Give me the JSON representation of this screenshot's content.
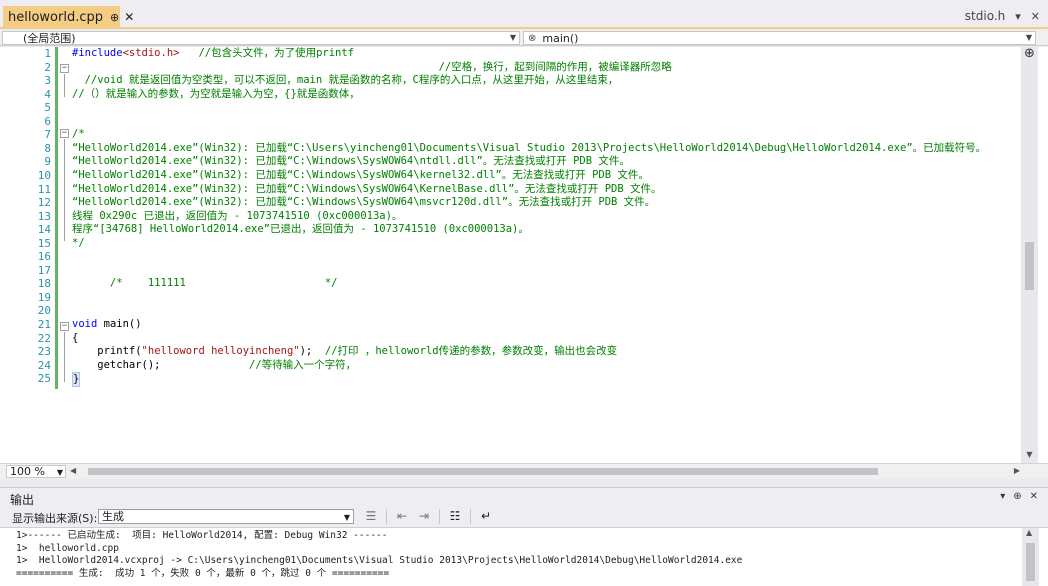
{
  "tabs": {
    "active": {
      "name": "helloworld.cpp",
      "pin": "⊕",
      "close": "✕"
    },
    "secondary": "stdio.h",
    "dropdown_icon": "▾",
    "close_icon": "✕"
  },
  "navbar": {
    "scope": "(全局范围)",
    "member": "main()"
  },
  "editor": {
    "lines": [
      {
        "n": "1",
        "parts": [
          [
            "pp",
            "#include"
          ],
          [
            "str",
            "<stdio.h>"
          ],
          [
            "cmt",
            "   //包含头文件，为了使用printf"
          ]
        ]
      },
      {
        "n": "2",
        "parts": [
          [
            "cmt",
            "                                                          //空格，换行，起到间隔的作用，被编译器所忽略"
          ]
        ]
      },
      {
        "n": "3",
        "parts": [
          [
            "cmt",
            "  //void 就是返回值为空类型，可以不返回，main 就是函数的名称，C程序的入口点，从这里开始，从这里结束，"
          ]
        ]
      },
      {
        "n": "4",
        "parts": [
          [
            "cmt",
            "//（）就是输入的参数，为空就是输入为空，{}就是函数体，"
          ]
        ]
      },
      {
        "n": "5",
        "parts": []
      },
      {
        "n": "6",
        "parts": []
      },
      {
        "n": "7",
        "parts": [
          [
            "cmt",
            "/*"
          ]
        ]
      },
      {
        "n": "8",
        "parts": [
          [
            "cmt",
            "“HelloWorld2014.exe”(Win32): 已加载“C:\\Users\\yincheng01\\Documents\\Visual Studio 2013\\Projects\\HelloWorld2014\\Debug\\HelloWorld2014.exe”。已加载符号。"
          ]
        ]
      },
      {
        "n": "9",
        "parts": [
          [
            "cmt",
            "“HelloWorld2014.exe”(Win32): 已加载“C:\\Windows\\SysWOW64\\ntdll.dll”。无法查找或打开 PDB 文件。"
          ]
        ]
      },
      {
        "n": "10",
        "parts": [
          [
            "cmt",
            "“HelloWorld2014.exe”(Win32): 已加载“C:\\Windows\\SysWOW64\\kernel32.dll”。无法查找或打开 PDB 文件。"
          ]
        ]
      },
      {
        "n": "11",
        "parts": [
          [
            "cmt",
            "“HelloWorld2014.exe”(Win32): 已加载“C:\\Windows\\SysWOW64\\KernelBase.dll”。无法查找或打开 PDB 文件。"
          ]
        ]
      },
      {
        "n": "12",
        "parts": [
          [
            "cmt",
            "“HelloWorld2014.exe”(Win32): 已加载“C:\\Windows\\SysWOW64\\msvcr120d.dll”。无法查找或打开 PDB 文件。"
          ]
        ]
      },
      {
        "n": "13",
        "parts": [
          [
            "cmt",
            "线程 0x290c 已退出，返回值为 - 1073741510 (0xc000013a)。"
          ]
        ]
      },
      {
        "n": "14",
        "parts": [
          [
            "cmt",
            "程序“[34768] HelloWorld2014.exe”已退出，返回值为 - 1073741510 (0xc000013a)。"
          ]
        ]
      },
      {
        "n": "15",
        "parts": [
          [
            "cmt",
            "*/"
          ]
        ]
      },
      {
        "n": "16",
        "parts": []
      },
      {
        "n": "17",
        "parts": []
      },
      {
        "n": "18",
        "parts": [
          [
            "cmt",
            "      /*    111111                      */"
          ]
        ]
      },
      {
        "n": "19",
        "parts": []
      },
      {
        "n": "20",
        "parts": []
      },
      {
        "n": "21",
        "parts": [
          [
            "kw",
            "void"
          ],
          [
            "plain",
            " main()"
          ]
        ]
      },
      {
        "n": "22",
        "parts": [
          [
            "plain",
            "{"
          ]
        ]
      },
      {
        "n": "23",
        "parts": [
          [
            "plain",
            "    printf("
          ],
          [
            "str",
            "\"helloword helloyincheng\""
          ],
          [
            "plain",
            ");  "
          ],
          [
            "cmt",
            "//打印 ，helloworld传递的参数，参数改变，输出也会改变"
          ]
        ]
      },
      {
        "n": "24",
        "parts": [
          [
            "plain",
            "    getchar();              "
          ],
          [
            "cmt",
            "//等待输入一个字符，"
          ]
        ]
      },
      {
        "n": "25",
        "parts": [
          [
            "cursor",
            "}"
          ]
        ]
      }
    ]
  },
  "zoom": "100 %",
  "output": {
    "title": "输出",
    "title_controls": [
      "▾",
      "⊕",
      "✕"
    ],
    "source_label": "显示输出来源(S):",
    "source_value": "生成",
    "toolbar_icons": [
      "align-left-icon",
      "indent-icon",
      "outdent-icon",
      "clear-all-icon",
      "word-wrap-icon"
    ],
    "lines": [
      "1>------ 已启动生成:  项目: HelloWorld2014, 配置: Debug Win32 ------",
      "1>  helloworld.cpp",
      "1>  HelloWorld2014.vcxproj -> C:\\Users\\yincheng01\\Documents\\Visual Studio 2013\\Projects\\HelloWorld2014\\Debug\\HelloWorld2014.exe",
      "========== 生成:  成功 1 个，失败 0 个，最新 0 个，跳过 0 个 =========="
    ]
  }
}
